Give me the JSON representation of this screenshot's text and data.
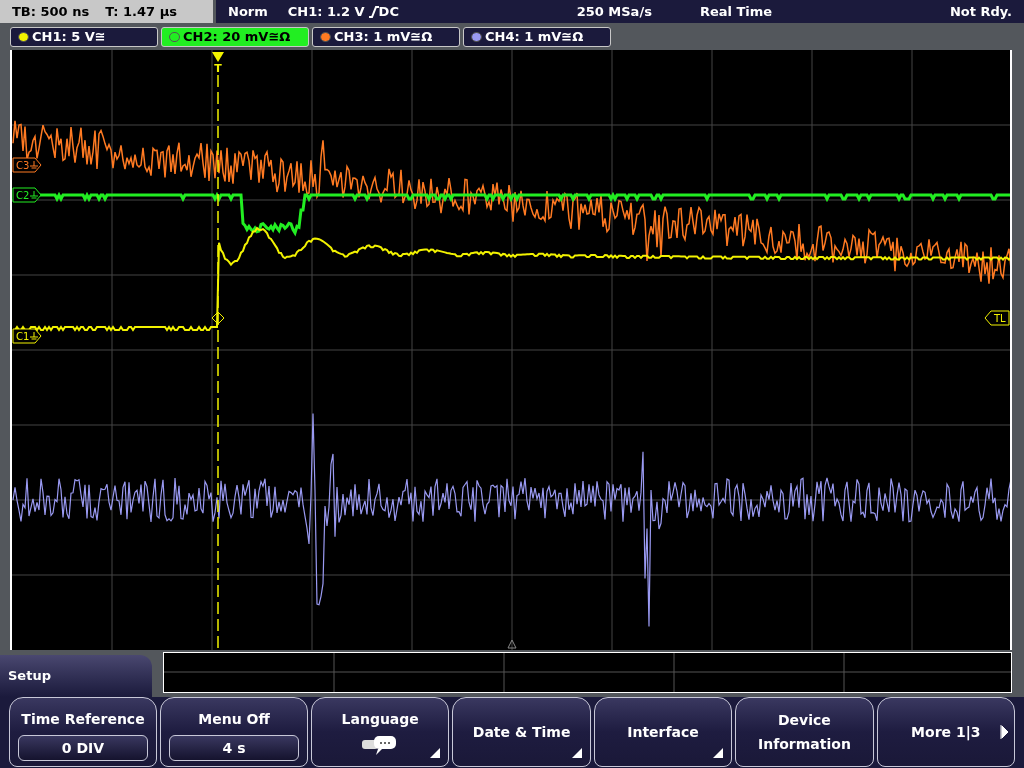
{
  "status_bar": {
    "timebase": "TB: 500 ns",
    "trigger_time": "T: 1.47 µs",
    "trigger_mode": "Norm",
    "trigger_source": "CH1: 1.2 V",
    "coupling": "DC",
    "sample_rate": "250 MSa/s",
    "acquisition": "Real Time",
    "state": "Not Rdy."
  },
  "channels": [
    {
      "label": "CH1: 5 V≅",
      "color": "#f2f200",
      "selected": false
    },
    {
      "label": "CH2: 20 mV≅Ω",
      "color": "#22ee22",
      "selected": true
    },
    {
      "label": "CH3: 1 mV≅Ω",
      "color": "#ff7a22",
      "selected": false
    },
    {
      "label": "CH4: 1 mV≅Ω",
      "color": "#9a9af2",
      "selected": false
    }
  ],
  "markers": {
    "trigger": "T",
    "ch3": "C3",
    "ch2": "C2",
    "ch1": "C1",
    "trigger_level": "TL"
  },
  "menu": {
    "title": "Setup",
    "buttons": [
      {
        "kind": "value",
        "label": "Time Reference",
        "value": "0 DIV"
      },
      {
        "kind": "value",
        "label": "Menu Off",
        "value": "4 s"
      },
      {
        "kind": "icon",
        "label": "Language",
        "submenu": true
      },
      {
        "kind": "plain",
        "label": "Date & Time",
        "submenu": true
      },
      {
        "kind": "plain",
        "label": "Interface",
        "submenu": true
      },
      {
        "kind": "plain",
        "label": "Device Information",
        "submenu": false
      },
      {
        "kind": "next",
        "label": "More 1|3",
        "submenu": false
      }
    ]
  }
}
